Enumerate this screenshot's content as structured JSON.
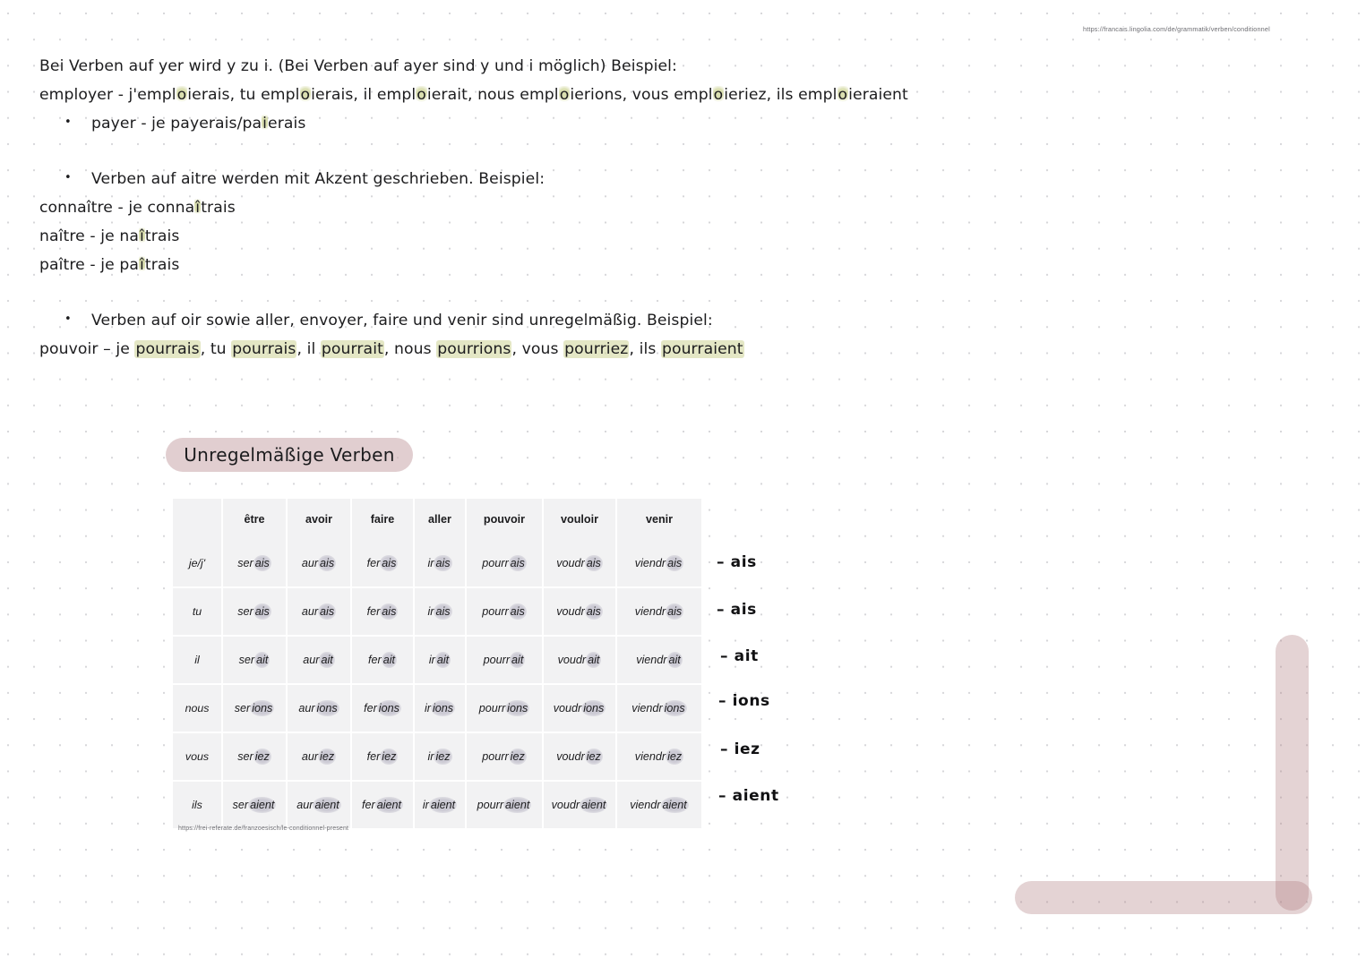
{
  "sources": {
    "top_right_url": "https://francais.lingolia.com/de/grammatik/verben/conditionnel",
    "table_url": "https://frei-referate.de/franzoesisch/le-conditionnel-present"
  },
  "notes": {
    "line1": "Bei Verben auf yer wird y zu i. (Bei Verben auf ayer sind y und i möglich) Beispiel:",
    "line2_parts": [
      "employer - j'empl",
      "o",
      "ierais, tu empl",
      "o",
      "ierais, il empl",
      "o",
      "ierait, nous empl",
      "o",
      "ierions, vous empl",
      "o",
      "ieriez, ils empl",
      "o",
      "ieraient"
    ],
    "bullet1_pre": "payer - je payerais/pa",
    "bullet1_hl": "i",
    "bullet1_post": "erais",
    "bullet2": "Verben auf aitre werden mit Akzent geschrieben. Beispiel:",
    "line_connaitre_a": "connaître - je conna",
    "line_connaitre_hl": "î",
    "line_connaitre_b": "trais",
    "line_naitre_a": "naître - je na",
    "line_naitre_hl": "î",
    "line_naitre_b": "trais",
    "line_paitre_a": "paître - je pa",
    "line_paitre_hl": "î",
    "line_paitre_b": "trais",
    "bullet3": "Verben auf oir sowie aller, envoyer, faire und venir sind unregelmäßig. Beispiel:",
    "line_pouvoir_pre": "pouvoir – je ",
    "line_pouvoir_h1": "pourrais",
    "line_pouvoir_s1": ", tu ",
    "line_pouvoir_h2": "pourrais",
    "line_pouvoir_s2": ", il ",
    "line_pouvoir_h3": "pourrait",
    "line_pouvoir_s3": ", nous ",
    "line_pouvoir_h4": "pourrions",
    "line_pouvoir_s4": ", vous ",
    "line_pouvoir_h5": "pourriez",
    "line_pouvoir_s5": ", ils ",
    "line_pouvoir_h6": "pourraient"
  },
  "section": {
    "banner_label": "Unregelmäßige Verben"
  },
  "table": {
    "corner": "",
    "headers": [
      "être",
      "avoir",
      "faire",
      "aller",
      "pouvoir",
      "vouloir",
      "venir"
    ],
    "rows": [
      {
        "pronoun": "je/j'",
        "cells": [
          {
            "stem": "ser",
            "ending": "ais"
          },
          {
            "stem": "aur",
            "ending": "ais"
          },
          {
            "stem": "fer",
            "ending": "ais"
          },
          {
            "stem": "ir",
            "ending": "ais"
          },
          {
            "stem": "pourr",
            "ending": "ais"
          },
          {
            "stem": "voudr",
            "ending": "ais"
          },
          {
            "stem": "viendr",
            "ending": "ais"
          }
        ],
        "ending_note": "– ais"
      },
      {
        "pronoun": "tu",
        "cells": [
          {
            "stem": "ser",
            "ending": "ais"
          },
          {
            "stem": "aur",
            "ending": "ais"
          },
          {
            "stem": "fer",
            "ending": "ais"
          },
          {
            "stem": "ir",
            "ending": "ais"
          },
          {
            "stem": "pourr",
            "ending": "ais"
          },
          {
            "stem": "voudr",
            "ending": "ais"
          },
          {
            "stem": "viendr",
            "ending": "ais"
          }
        ],
        "ending_note": "– ais"
      },
      {
        "pronoun": "il",
        "cells": [
          {
            "stem": "ser",
            "ending": "ait"
          },
          {
            "stem": "aur",
            "ending": "ait"
          },
          {
            "stem": "fer",
            "ending": "ait"
          },
          {
            "stem": "ir",
            "ending": "ait"
          },
          {
            "stem": "pourr",
            "ending": "ait"
          },
          {
            "stem": "voudr",
            "ending": "ait"
          },
          {
            "stem": "viendr",
            "ending": "ait"
          }
        ],
        "ending_note": "– ait"
      },
      {
        "pronoun": "nous",
        "cells": [
          {
            "stem": "ser",
            "ending": "ions"
          },
          {
            "stem": "aur",
            "ending": "ions"
          },
          {
            "stem": "fer",
            "ending": "ions"
          },
          {
            "stem": "ir",
            "ending": "ions"
          },
          {
            "stem": "pourr",
            "ending": "ions"
          },
          {
            "stem": "voudr",
            "ending": "ions"
          },
          {
            "stem": "viendr",
            "ending": "ions"
          }
        ],
        "ending_note": "– ions"
      },
      {
        "pronoun": "vous",
        "cells": [
          {
            "stem": "ser",
            "ending": "iez"
          },
          {
            "stem": "aur",
            "ending": "iez"
          },
          {
            "stem": "fer",
            "ending": "iez"
          },
          {
            "stem": "ir",
            "ending": "iez"
          },
          {
            "stem": "pourr",
            "ending": "iez"
          },
          {
            "stem": "voudr",
            "ending": "iez"
          },
          {
            "stem": "viendr",
            "ending": "iez"
          }
        ],
        "ending_note": "– iez"
      },
      {
        "pronoun": "ils",
        "cells": [
          {
            "stem": "ser",
            "ending": "aient"
          },
          {
            "stem": "aur",
            "ending": "aient"
          },
          {
            "stem": "fer",
            "ending": "aient"
          },
          {
            "stem": "ir",
            "ending": "aient"
          },
          {
            "stem": "pourr",
            "ending": "aient"
          },
          {
            "stem": "voudr",
            "ending": "aient"
          },
          {
            "stem": "viendr",
            "ending": "aient"
          }
        ],
        "ending_note": "– aient"
      }
    ]
  },
  "colors": {
    "page_background": "#ffffff",
    "grid_dot": "#787882",
    "banner_pink": "#cbb0b3",
    "deco_pink": "#ad787d",
    "highlight_green": "#ced496",
    "table_cell": "#f2f2f3",
    "ending_blob": "#9692a8",
    "text": "#1c1c1e"
  }
}
